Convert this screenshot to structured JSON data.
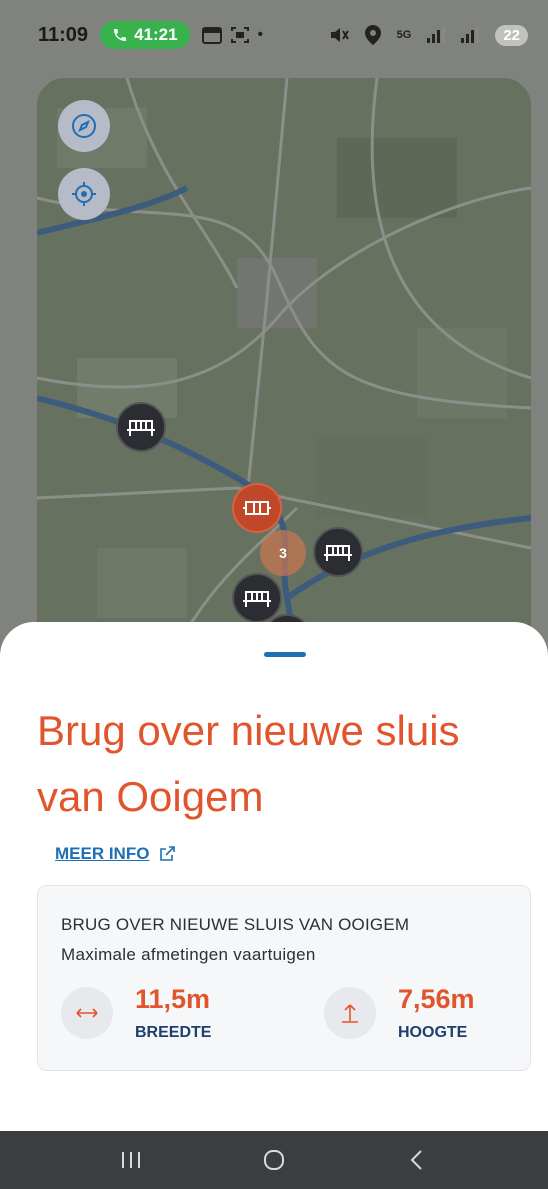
{
  "status_bar": {
    "time": "11:09",
    "call_timer": "41:21",
    "battery": "22",
    "icons": [
      "phone-icon",
      "calendar-icon",
      "screenshot-icon",
      "dot-icon",
      "mute-icon",
      "location-icon",
      "5g-icon",
      "signal-icon",
      "signal-icon",
      "battery-icon"
    ]
  },
  "map": {
    "buttons": [
      "compass-icon",
      "locate-icon"
    ],
    "markers": [
      "bridge-marker",
      "bridge-marker",
      "bridge-marker",
      "lock-marker-active"
    ],
    "cluster_count": "3"
  },
  "sheet": {
    "title_line1": "Brug over nieuwe sluis",
    "title_line2": "van Ooigem",
    "more_info": "MEER INFO",
    "card": {
      "name": "BRUG OVER NIEUWE SLUIS VAN OOIGEM",
      "subtitle": "Maximale afmetingen vaartuigen",
      "width_value": "11,5m",
      "width_label": "BREEDTE",
      "height_value": "7,56m",
      "height_label": "HOOGTE"
    }
  },
  "colors": {
    "accent": "#e2552c",
    "link": "#1f6fb4",
    "label_dark": "#1d3f6b",
    "call_green": "#37b24d"
  }
}
